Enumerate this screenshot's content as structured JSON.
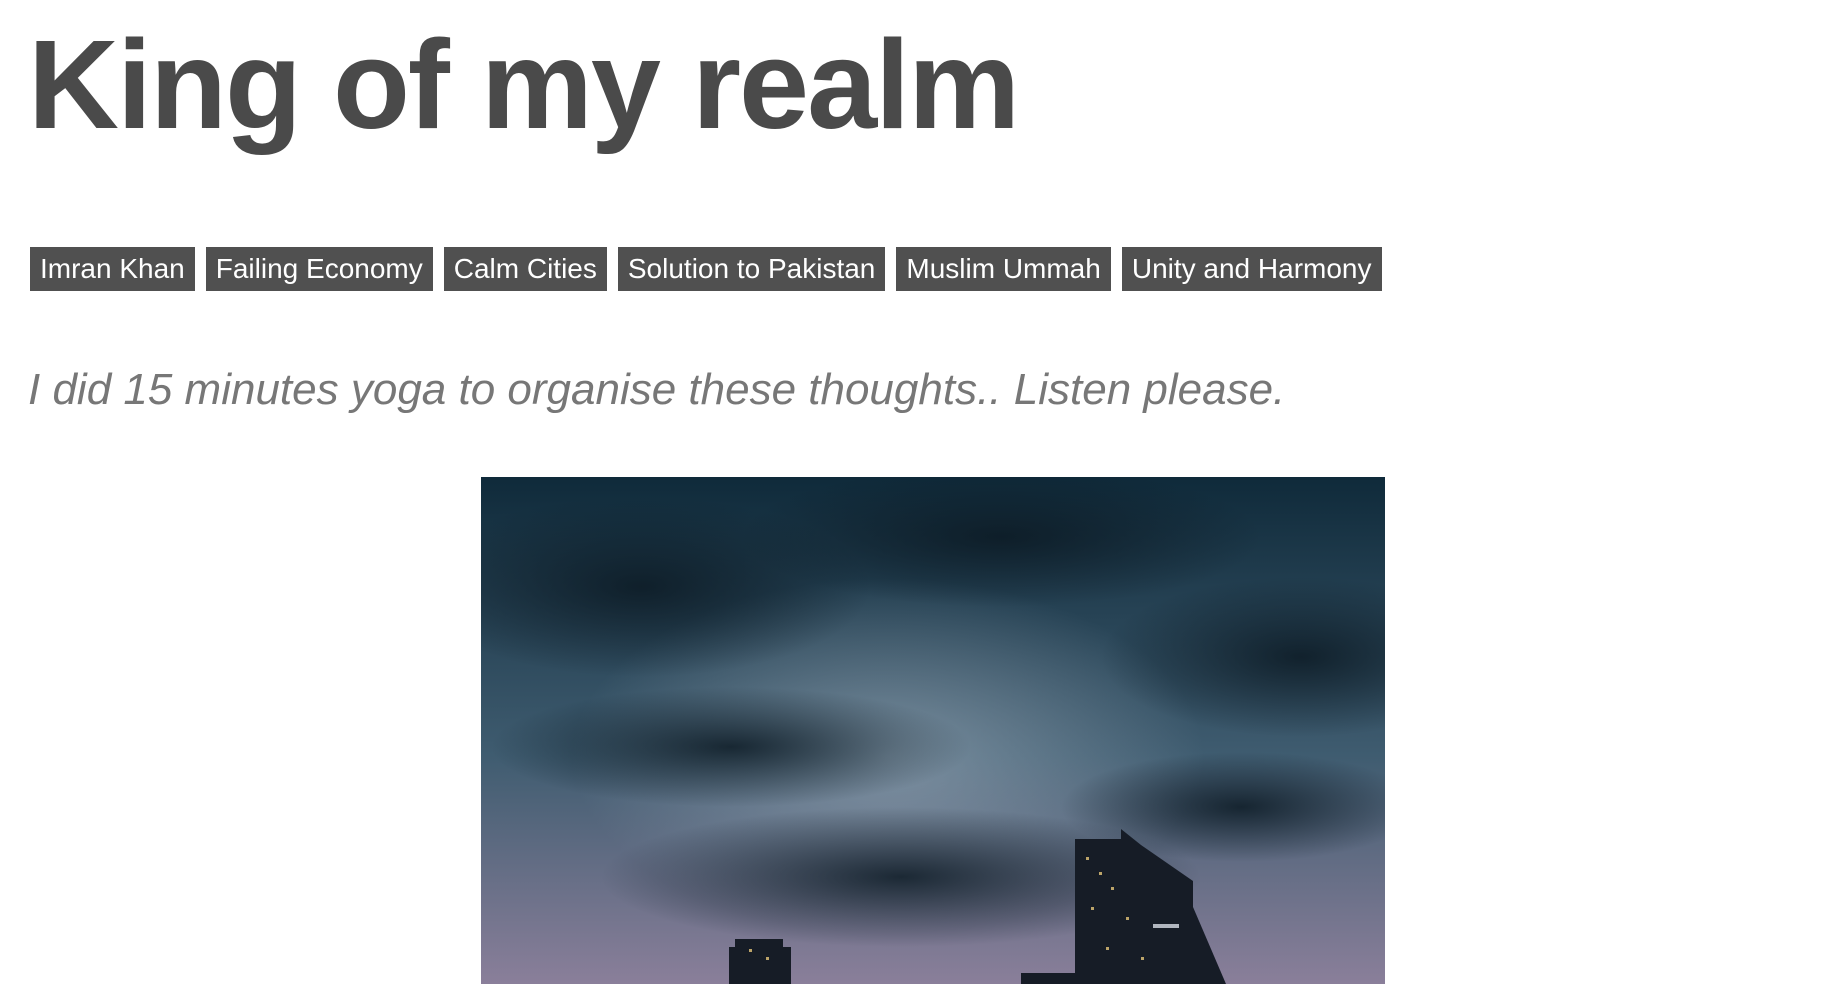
{
  "post": {
    "title": "King of my realm",
    "tags": [
      "Imran Khan",
      "Failing Economy",
      "Calm Cities",
      "Solution to Pakistan",
      "Muslim Ummah",
      "Unity and Harmony"
    ],
    "subtitle": "I did 15 minutes yoga to organise these thoughts.. Listen please."
  },
  "hero_image": {
    "description_icon": "city-skyline-photo",
    "colors": {
      "sky_top": "#0f2a3a",
      "sky_mid": "#3f5c70",
      "sky_horizon": "#8a7f9a",
      "building": "#161c26"
    }
  }
}
